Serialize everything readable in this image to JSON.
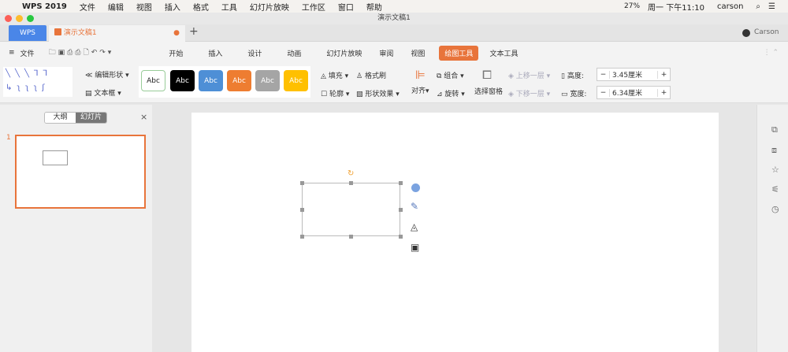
{
  "menubar": {
    "app": "WPS 2019",
    "items": [
      "文件",
      "编辑",
      "视图",
      "插入",
      "格式",
      "工具",
      "幻灯片放映",
      "工作区",
      "窗口",
      "帮助"
    ],
    "battery": "27%",
    "clock": "周一 下午11:10",
    "user": "carson"
  },
  "window": {
    "title": "演示文稿1"
  },
  "tabs": {
    "home": "WPS",
    "doc": "演示文稿1",
    "add": "+",
    "account": "Carson"
  },
  "menu": {
    "file": "文件",
    "items": [
      "开始",
      "插入",
      "设计",
      "动画",
      "幻灯片放映",
      "审阅",
      "视图",
      "绘图工具",
      "文本工具"
    ],
    "active": "绘图工具"
  },
  "ribbon": {
    "edit_shape": "编辑形状",
    "text_box": "文本框",
    "styles": [
      {
        "label": "Abc",
        "bg": "#ffffff",
        "fg": "#222"
      },
      {
        "label": "Abc",
        "bg": "#000000",
        "fg": "#fff"
      },
      {
        "label": "Abc",
        "bg": "#4e8fd6",
        "fg": "#fff"
      },
      {
        "label": "Abc",
        "bg": "#ee7d31",
        "fg": "#fff"
      },
      {
        "label": "Abc",
        "bg": "#a5a5a5",
        "fg": "#fff"
      },
      {
        "label": "Abc",
        "bg": "#ffc000",
        "fg": "#fff"
      }
    ],
    "fill": "填充",
    "format_painter": "格式刷",
    "outline": "轮廓",
    "shape_effects": "形状效果",
    "align": "对齐",
    "group": "组合",
    "rotate": "旋转",
    "selection_pane": "选择窗格",
    "bring_forward": "上移一层",
    "send_backward": "下移一层",
    "height_label": "高度:",
    "height_value": "3.45厘米",
    "width_label": "宽度:",
    "width_value": "6.34厘米",
    "minus": "−",
    "plus": "+"
  },
  "left_panel": {
    "tab_outline": "大纲",
    "tab_slides": "幻灯片",
    "active": "幻灯片",
    "close": "×",
    "slide_numbers": [
      "1"
    ]
  },
  "colors": {
    "accent": "#e8743b",
    "wps_blue": "#4a86e8"
  }
}
